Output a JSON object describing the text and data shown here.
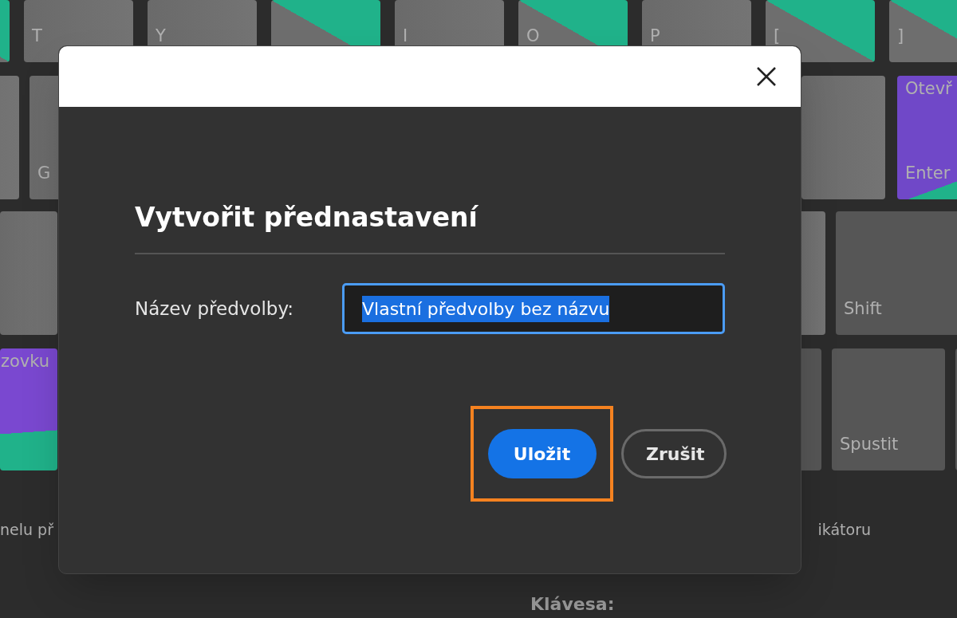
{
  "keyboard": {
    "rows": [
      {
        "keys": [
          {
            "kind": "green"
          },
          {
            "label": "T",
            "kind": "plain"
          },
          {
            "label": "Y",
            "kind": "plain"
          },
          {
            "kind": "green"
          },
          {
            "label": "I",
            "kind": "plain"
          },
          {
            "label": "O",
            "kind": "green"
          },
          {
            "label": "P",
            "kind": "plain"
          },
          {
            "label": "[",
            "kind": "green"
          },
          {
            "label": "]",
            "kind": "green"
          }
        ]
      },
      {
        "keys": [
          {
            "kind": "plain"
          },
          {
            "label": "G",
            "kind": "plain"
          },
          {
            "kind": "plain"
          },
          {
            "caption": "Otevř",
            "label": "Enter",
            "kind": "purple"
          }
        ]
      },
      {
        "keys": [
          {
            "kind": "plain"
          },
          {
            "kind": "plain"
          },
          {
            "label": "Shift",
            "kind": "dark"
          }
        ]
      },
      {
        "keys": [
          {
            "caption": "zovku",
            "kind": "purple_band"
          },
          {
            "kind": "dark"
          },
          {
            "label": "Spustit",
            "kind": "dark"
          },
          {
            "kind": "dark"
          }
        ]
      }
    ]
  },
  "bottom_texts": [
    "nelu př",
    "ikátoru"
  ],
  "key_caption": "Klávesa:",
  "dialog": {
    "title": "Vytvořit přednastavení",
    "field": {
      "label": "Název předvolby:",
      "value": "Vlastní předvolby bez názvu",
      "text_selected": true,
      "focused": true
    },
    "buttons": [
      {
        "label": "Uložit",
        "kind": "primary",
        "highlighted": true
      },
      {
        "label": "Zrušit",
        "kind": "secondary",
        "highlighted": false
      }
    ]
  }
}
